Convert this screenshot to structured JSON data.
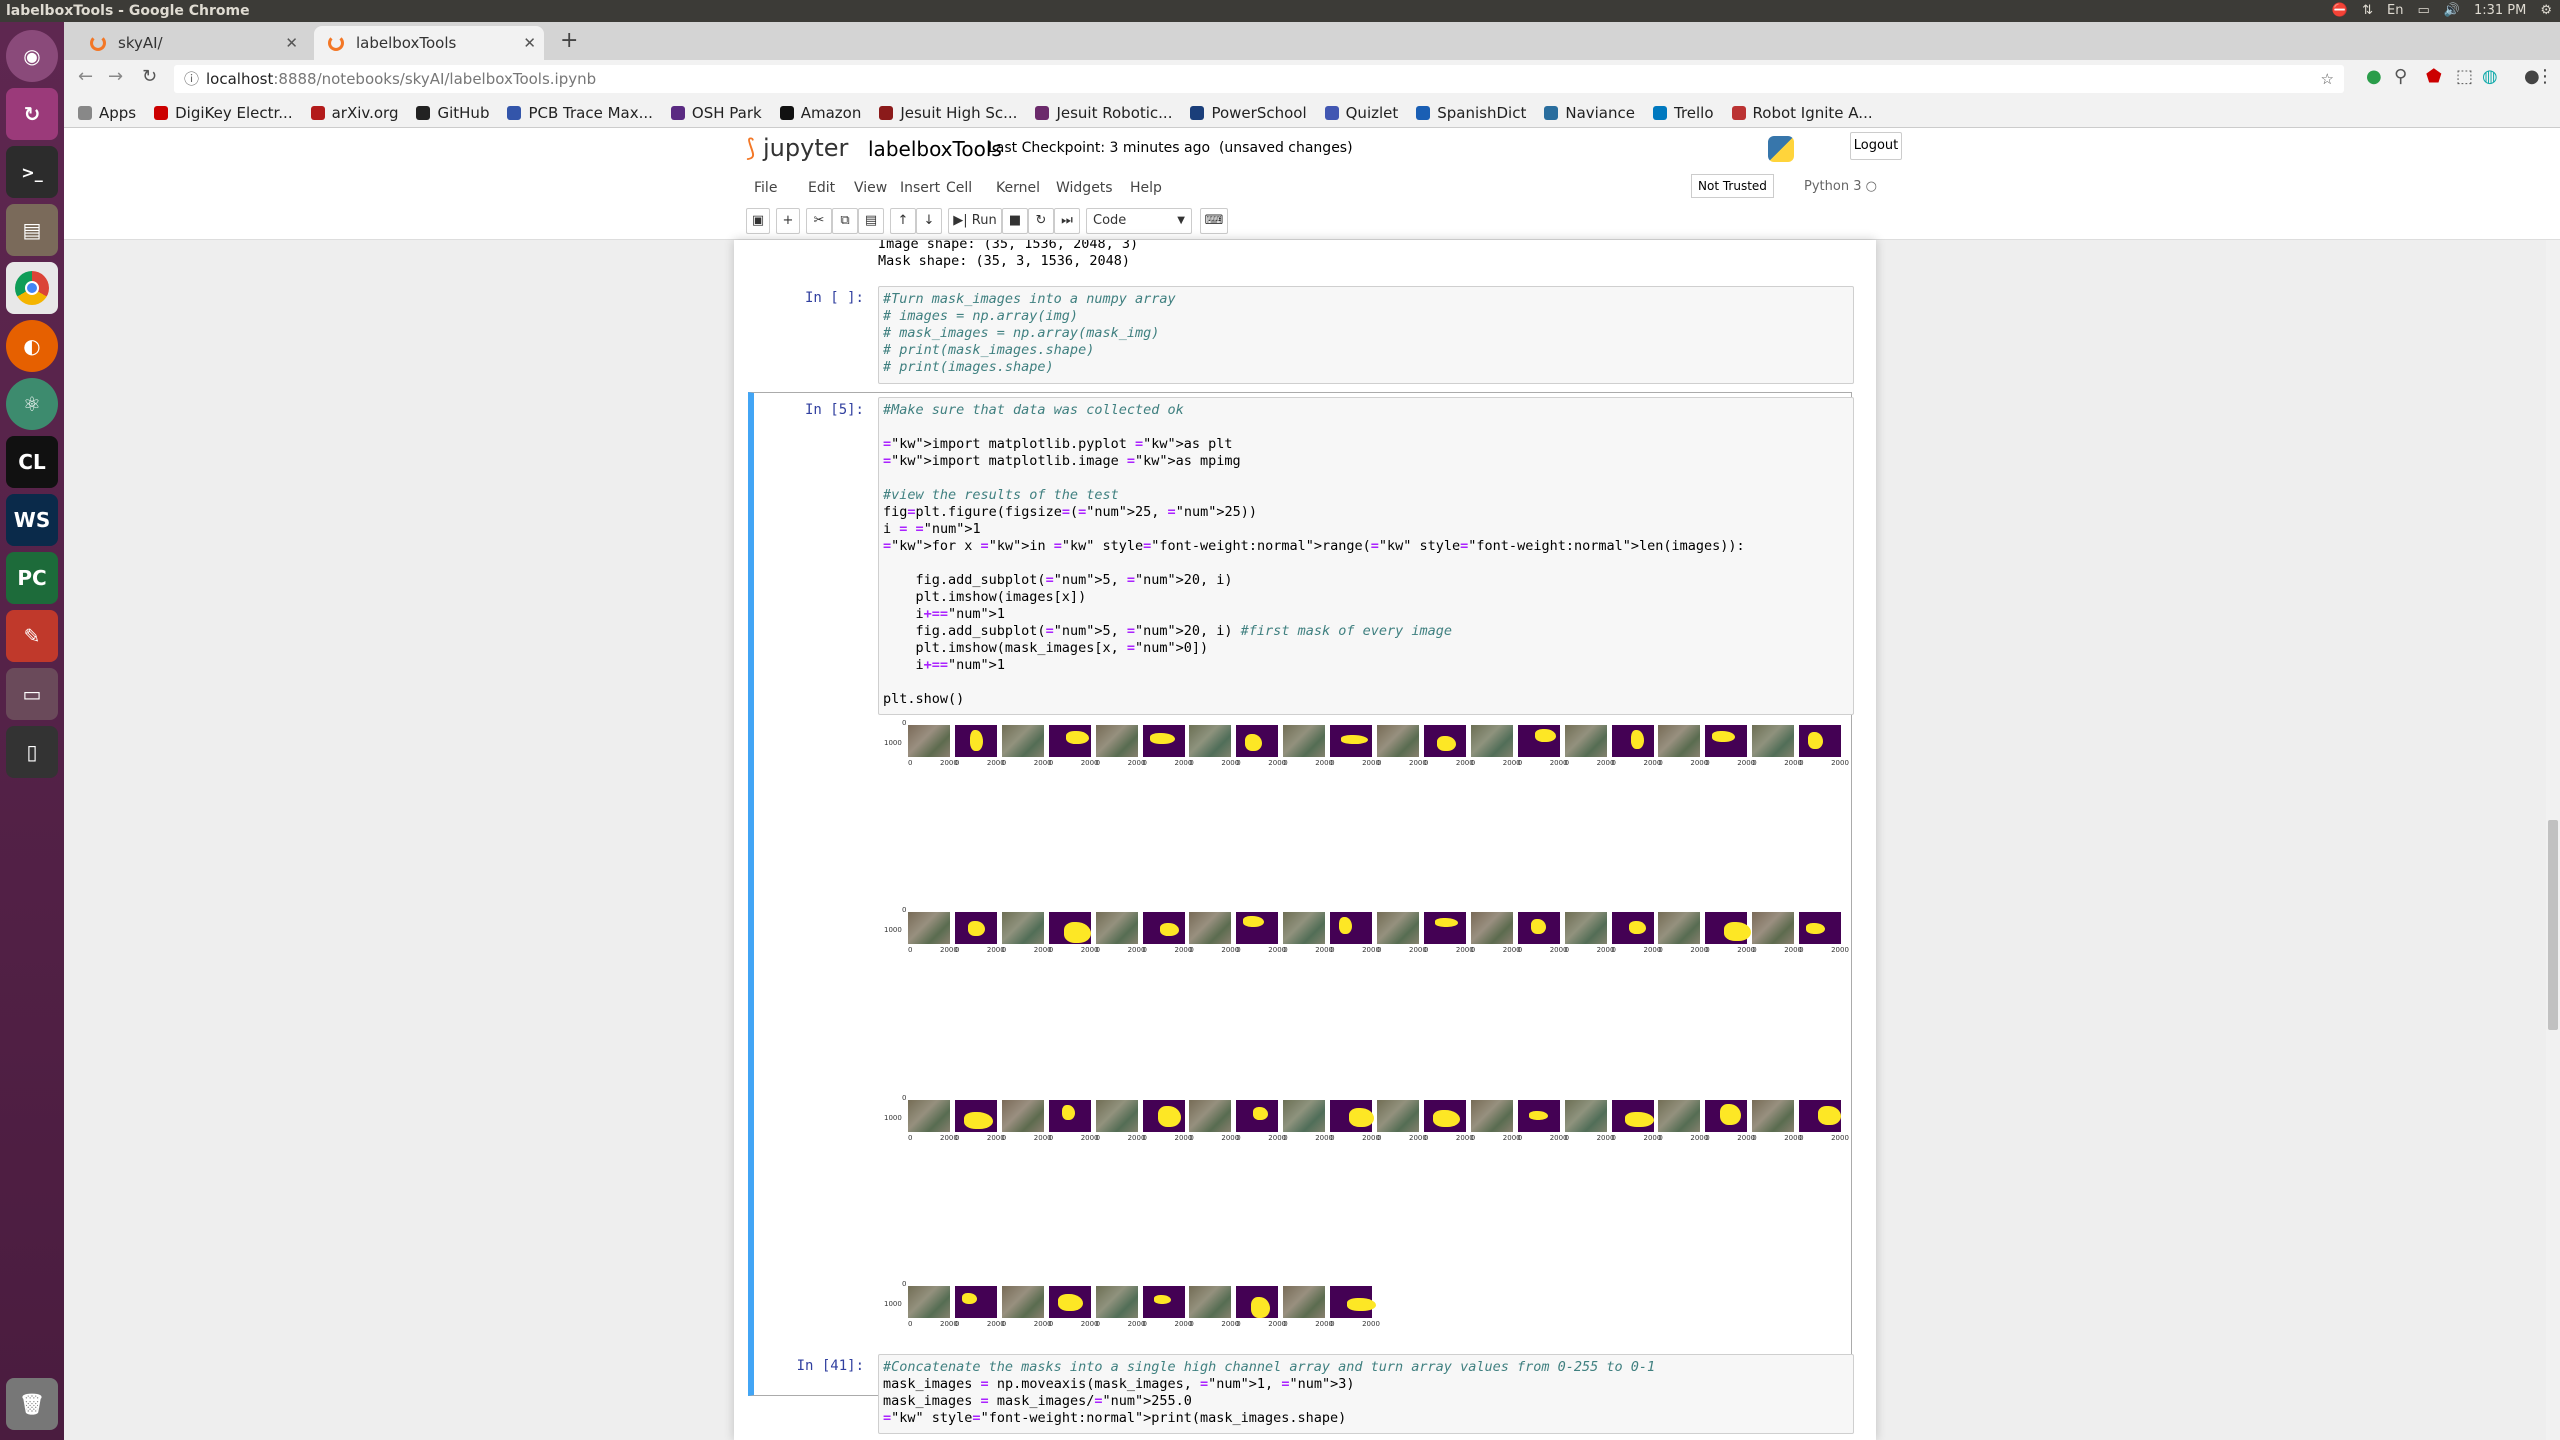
{
  "os": {
    "window_title": "labelboxTools - Google Chrome",
    "tray": {
      "lang": "En",
      "time": "1:31 PM"
    }
  },
  "launcher": {
    "items": [
      "ubuntu-icon",
      "update-icon",
      "terminal-icon",
      "files-icon",
      "chrome-icon",
      "firefox-icon",
      "atom-icon",
      "clion-icon",
      "webstorm-icon",
      "pycharm-icon",
      "settings-tool-icon",
      "drive-icon",
      "device-icon",
      "trash-icon"
    ],
    "clion_label": "CL",
    "webstorm_label": "WS",
    "pycharm_label": "PC"
  },
  "browser": {
    "tabs": [
      {
        "label": "skyAI/"
      },
      {
        "label": "labelboxTools"
      }
    ],
    "url_host": "localhost",
    "url_rest": ":8888/notebooks/skyAI/labelboxTools.ipynb",
    "bookmarks": [
      {
        "label": "Apps",
        "color": "#888888"
      },
      {
        "label": "DigiKey Electr...",
        "color": "#cc0000"
      },
      {
        "label": "arXiv.org",
        "color": "#b31b1b"
      },
      {
        "label": "GitHub",
        "color": "#222222"
      },
      {
        "label": "PCB Trace Max...",
        "color": "#3355aa"
      },
      {
        "label": "OSH Park",
        "color": "#5a2a82"
      },
      {
        "label": "Amazon",
        "color": "#111111"
      },
      {
        "label": "Jesuit High Sc...",
        "color": "#8b1a1a"
      },
      {
        "label": "Jesuit Robotic...",
        "color": "#6b2a6b"
      },
      {
        "label": "PowerSchool",
        "color": "#1a3e7a"
      },
      {
        "label": "Quizlet",
        "color": "#4257b2"
      },
      {
        "label": "SpanishDict",
        "color": "#1a5fb4"
      },
      {
        "label": "Naviance",
        "color": "#2a6e9e"
      },
      {
        "label": "Trello",
        "color": "#0079bf"
      },
      {
        "label": "Robot Ignite A...",
        "color": "#b33"
      }
    ]
  },
  "jupyter": {
    "logo_text": "jupyter",
    "notebook_name": "labelboxTools",
    "checkpoint": "Last Checkpoint: 3 minutes ago",
    "unsaved": "(unsaved changes)",
    "logout": "Logout",
    "menu": [
      "File",
      "Edit",
      "View",
      "Insert",
      "Cell",
      "Kernel",
      "Widgets",
      "Help"
    ],
    "trust": "Not Trusted",
    "kernel": "Python 3",
    "toolbar": {
      "run": "Run",
      "cell_type": "Code"
    }
  },
  "cells": {
    "prev_output": [
      "Image shape: (35, 1536, 2048, 3)",
      "Mask shape: (35, 3, 1536, 2048)"
    ],
    "cell1": {
      "prompt": "In [ ]:",
      "lines": [
        "#Turn mask_images into a numpy array",
        "# images = np.array(img)",
        "# mask_images = np.array(mask_img)",
        "# print(mask_images.shape)",
        "# print(images.shape)"
      ]
    },
    "cell2": {
      "prompt": "In [5]:",
      "lines": [
        "#Make sure that data was collected ok",
        "",
        "import matplotlib.pyplot as plt",
        "import matplotlib.image as mpimg",
        "",
        "#view the results of the test",
        "fig=plt.figure(figsize=(25, 25))",
        "i = 1",
        "for x in range(len(images)):",
        "",
        "    fig.add_subplot(5, 20, i)",
        "    plt.imshow(images[x])",
        "    i+=1",
        "    fig.add_subplot(5, 20, i) #first mask of every image",
        "    plt.imshow(mask_images[x, 0])",
        "    i+=1",
        "",
        "plt.show()"
      ]
    },
    "cell3": {
      "prompt": "In [41]:",
      "lines": [
        "#Concatenate the masks into a single high channel array and turn array values from 0-255 to 0-1",
        "mask_images = np.moveaxis(mask_images, 1, 3)",
        "mask_images = mask_images/255.0",
        "print(mask_images.shape)"
      ]
    }
  },
  "figure": {
    "rows": [
      20,
      20,
      20,
      10
    ],
    "ytick_top": "0",
    "ytick_mid": "1000",
    "xtick_left": "0",
    "xtick_right": "2000"
  }
}
